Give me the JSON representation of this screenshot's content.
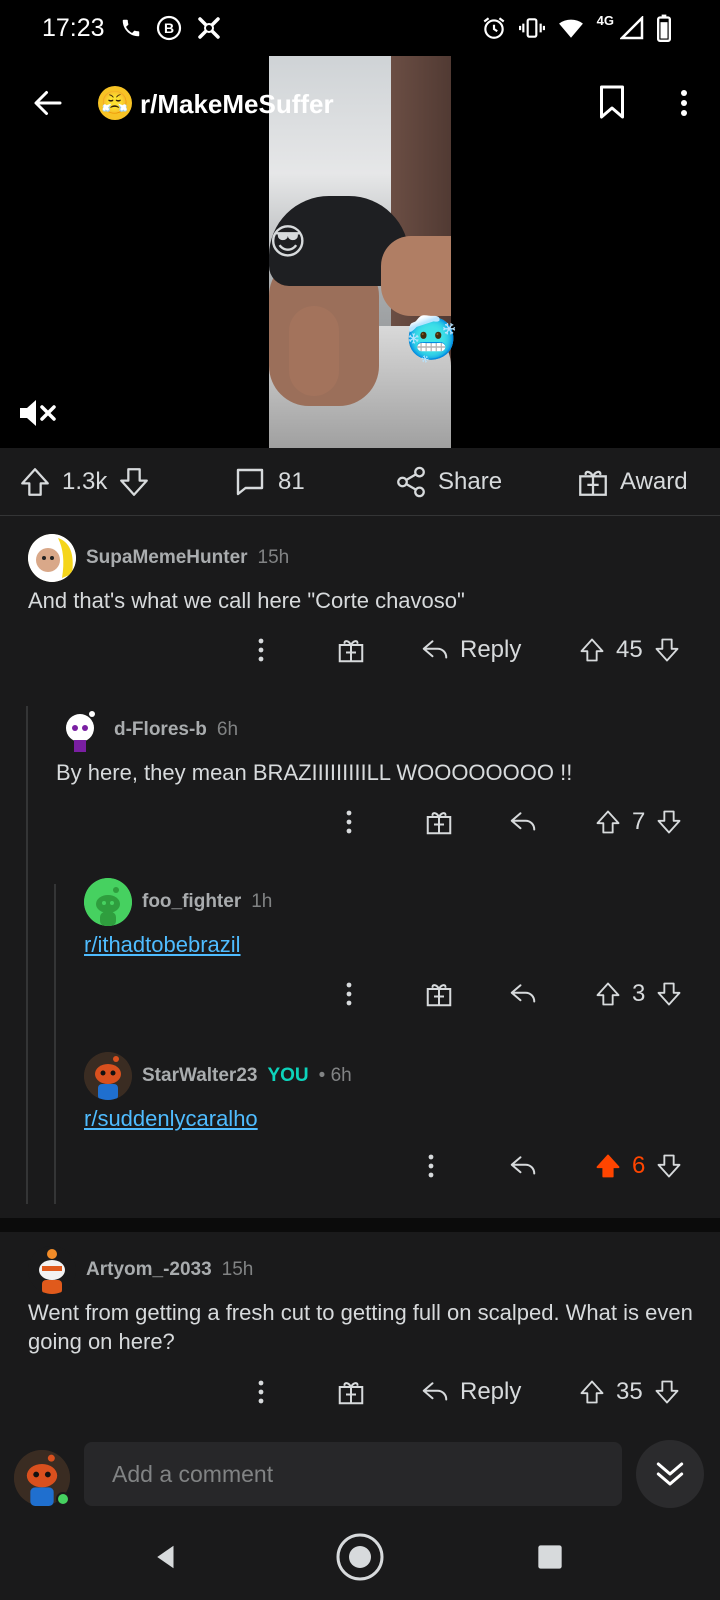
{
  "status_bar": {
    "time": "17:23",
    "network": "4G",
    "left_icons": [
      "phone-icon",
      "b-badge-icon",
      "app-icon"
    ],
    "right_icons": [
      "alarm-icon",
      "vibrate-icon",
      "wifi-icon",
      "signal-icon",
      "battery-icon"
    ]
  },
  "header": {
    "subreddit": "r/MakeMeSuffer",
    "subreddit_avatar": "😤"
  },
  "video": {
    "emoji_top": "😎",
    "emoji_bottom": "🥶"
  },
  "action_bar": {
    "votes": "1.3k",
    "comments": "81",
    "share_label": "Share",
    "award_label": "Award"
  },
  "comments": [
    {
      "username": "SupaMemeHunter",
      "time": "15h",
      "body": "And that's what we call here \"Corte chavoso\"",
      "reply_label": "Reply",
      "score": "45"
    },
    {
      "username": "d-Flores-b",
      "time": "6h",
      "body": "By here, they mean BRAZIIIIIIIIILL WOOOOOOOO !!",
      "score": "7"
    },
    {
      "username": "foo_fighter",
      "time": "1h",
      "link": "r/ithadtobebrazil",
      "score": "3"
    },
    {
      "username": "StarWalter23",
      "you_tag": "YOU",
      "time": "• 6h",
      "link": "r/suddenlycaralho",
      "score": "6",
      "upvoted": true,
      "upvote_color": "#ff4500"
    },
    {
      "username": "Artyom_-2033",
      "time": "15h",
      "body": "Went from getting a fresh cut to getting full on scalped. What is even going on here?",
      "reply_label": "Reply",
      "score": "35"
    }
  ],
  "comment_bar": {
    "placeholder": "Add a comment"
  },
  "colors": {
    "background": "#1a1a1b",
    "text": "#d7dadc",
    "meta": "#818384",
    "link": "#4fbcff",
    "you_tag": "#0dd3bb",
    "upvote_active": "#ff4500"
  }
}
